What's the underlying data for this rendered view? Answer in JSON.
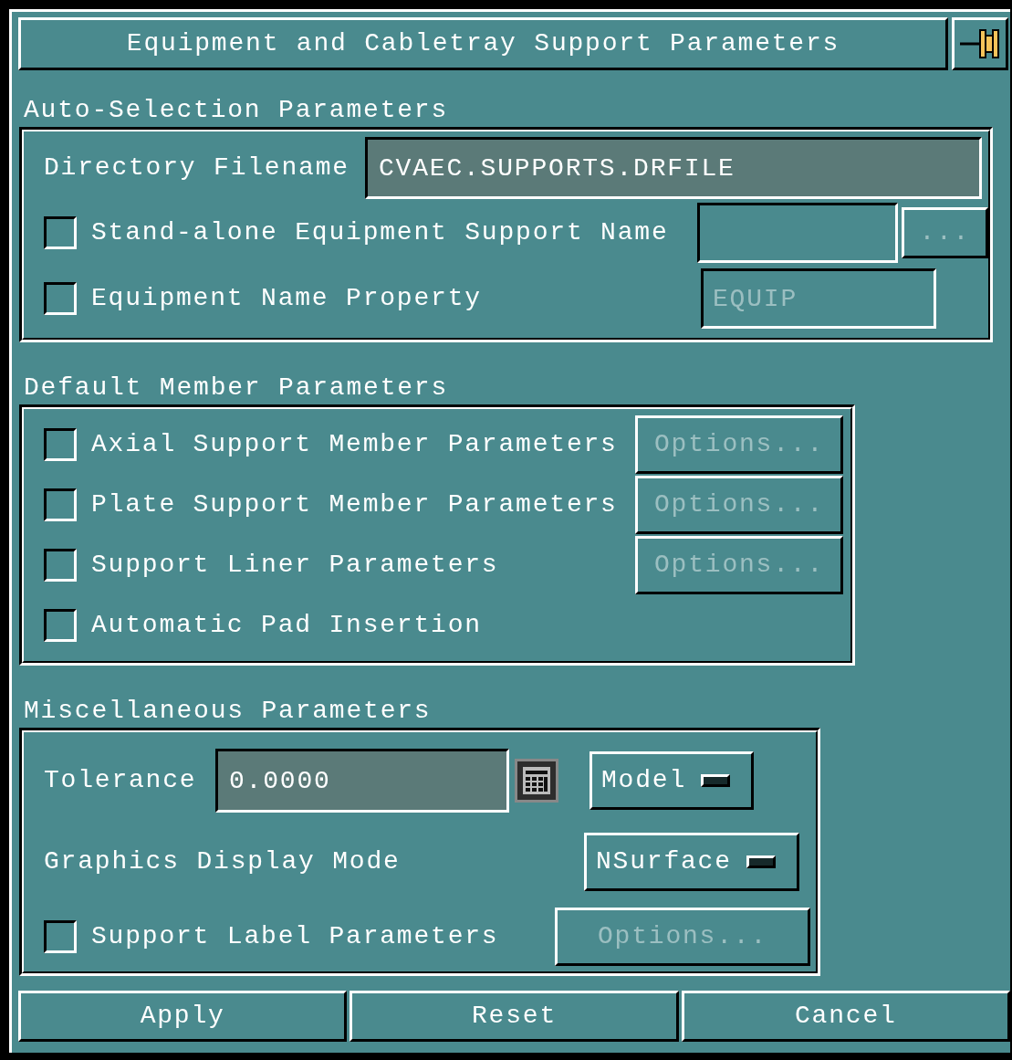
{
  "dialog": {
    "title": "Equipment and Cabletray Support Parameters"
  },
  "auto_selection": {
    "title": "Auto-Selection Parameters",
    "directory": {
      "label": "Directory Filename",
      "value": "CVAEC.SUPPORTS.DRFILE"
    },
    "rows": [
      {
        "label": "Stand-alone Equipment Support Name",
        "checked": false,
        "button": {
          "label": "...",
          "disabled": true
        }
      },
      {
        "label": "Equipment Name Property",
        "checked": false,
        "field": {
          "value": "EQUIP",
          "disabled": true
        }
      }
    ]
  },
  "default_member": {
    "title": "Default Member Parameters",
    "rows": [
      {
        "label": "Axial Support Member Parameters",
        "checked": false,
        "button": {
          "label": "Options...",
          "disabled": true
        }
      },
      {
        "label": "Plate Support Member Parameters",
        "checked": false,
        "button": {
          "label": "Options...",
          "disabled": true
        }
      },
      {
        "label": "Support Liner Parameters",
        "checked": false,
        "button": {
          "label": "Options...",
          "disabled": true
        }
      },
      {
        "label": "Automatic Pad Insertion",
        "checked": false
      }
    ]
  },
  "miscellaneous": {
    "title": "Miscellaneous Parameters",
    "tolerance": {
      "label": "Tolerance",
      "value": "0.0000",
      "units": "Model"
    },
    "display_mode": {
      "label": "Graphics Display Mode",
      "option": "NSurface"
    },
    "label_row": {
      "label": "Support Label Parameters",
      "checked": false,
      "button": {
        "label": "Options...",
        "disabled": true
      }
    }
  },
  "buttons": [
    "Apply",
    "Reset",
    "Cancel"
  ]
}
